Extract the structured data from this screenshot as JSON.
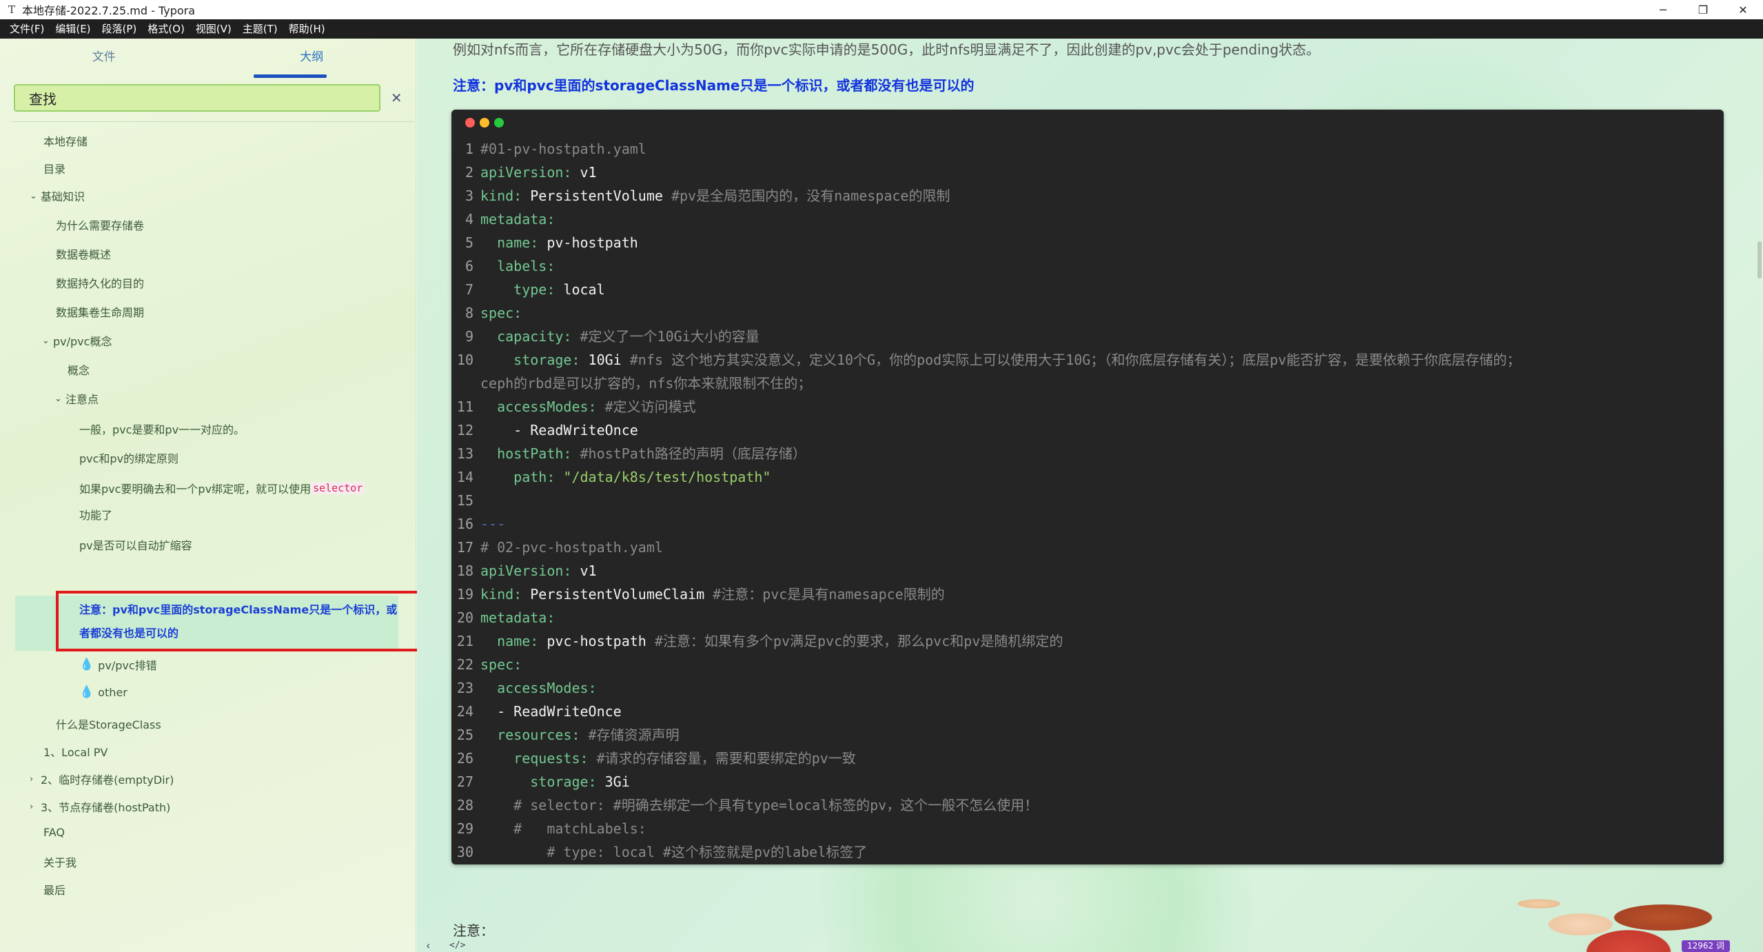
{
  "window": {
    "app_icon": "T",
    "title": "本地存储-2022.7.25.md - Typora",
    "minimize": "─",
    "maximize": "❐",
    "close": "✕"
  },
  "menu": [
    "文件(F)",
    "编辑(E)",
    "段落(P)",
    "格式(O)",
    "视图(V)",
    "主题(T)",
    "帮助(H)"
  ],
  "sidebar": {
    "tabs": {
      "files": "文件",
      "outline": "大纲"
    },
    "search": {
      "value": "查找",
      "close": "✕"
    },
    "outline": {
      "i1": "本地存储",
      "i2": "目录",
      "i3": "基础知识",
      "i4": "为什么需要存储卷",
      "i5": "数据卷概述",
      "i6": "数据持久化的目的",
      "i7": "数据集卷生命周期",
      "i8": "pv/pvc概念",
      "i9": "概念",
      "i10": "注意点",
      "i11": "一般，pvc是要和pv一一对应的。",
      "i12": "pvc和pv的绑定原则",
      "i13a": "如果pvc要明确去和一个pv绑定呢，就可以使用",
      "i13code": "selector",
      "i13b": "功能了",
      "i14": "pv是否可以自动扩缩容",
      "active": "注意：pv和pvc里面的storageClassName只是一个标识，或者都没有也是可以的",
      "i16": "pv/pvc排错",
      "i17": "other",
      "i18": "什么是StorageClass",
      "i19": "1、Local PV",
      "i20": "2、临时存储卷(emptyDir)",
      "i21": "3、节点存储卷(hostPath)",
      "i22": "FAQ",
      "i23": "关于我",
      "i24": "最后"
    }
  },
  "content": {
    "para1": "例如对nfs而言，它所在存储硬盘大小为50G，而你pvc实际申请的是500G，此时nfs明显满足不了，因此创建的pv,pvc会处于pending状态。",
    "note": "注意：pv和pvc里面的storageClassName只是一个标识，或者都没有也是可以的",
    "bottom_note": "注意：",
    "code": {
      "l1": "#01-pv-hostpath.yaml",
      "l2k": "apiVersion:",
      "l2v": " v1",
      "l3k": "kind:",
      "l3v": " PersistentVolume ",
      "l3c": "#pv是全局范围内的，没有namespace的限制",
      "l4k": "metadata:",
      "l5k": "  name:",
      "l5v": " pv-hostpath",
      "l6k": "  labels:",
      "l7k": "    type:",
      "l7v": " local",
      "l8k": "spec:",
      "l9k": "  capacity:",
      "l9c": " #定义了一个10Gi大小的容量",
      "l10k": "    storage:",
      "l10v": " 10Gi ",
      "l10c": "#nfs 这个地方其实没意义，定义10个G，你的pod实际上可以使用大于10G；（和你底层存储有关）；底层pv能否扩容，是要依赖于你底层存储的；",
      "l10w": "ceph的rbd是可以扩容的，nfs你本来就限制不住的；",
      "l11k": "  accessModes:",
      "l11c": " #定义访问模式",
      "l12v": "    - ReadWriteOnce",
      "l13k": "  hostPath:",
      "l13c": " #hostPath路径的声明（底层存储）",
      "l14k": "    path:",
      "l14s": " \"/data/k8s/test/hostpath\"",
      "l15": "",
      "l16": "---",
      "l17": "# 02-pvc-hostpath.yaml",
      "l18k": "apiVersion:",
      "l18v": " v1",
      "l19k": "kind:",
      "l19v": " PersistentVolumeClaim ",
      "l19c": "#注意：pvc是具有namesapce限制的",
      "l20k": "metadata:",
      "l21k": "  name:",
      "l21v": " pvc-hostpath ",
      "l21c": "#注意：如果有多个pv满足pvc的要求，那么pvc和pv是随机绑定的",
      "l22k": "spec:",
      "l23k": "  accessModes:",
      "l24v": "  - ReadWriteOnce",
      "l25k": "  resources:",
      "l25c": " #存储资源声明",
      "l26k": "    requests:",
      "l26c": " #请求的存储容量，需要和要绑定的pv一致",
      "l27k": "      storage:",
      "l27v": " 3Gi",
      "l28c": "    # selector: #明确去绑定一个具有type=local标签的pv，这个一般不怎么使用！",
      "l29c": "    #   matchLabels:",
      "l30c": "        # type: local #这个标签就是pv的label标签了"
    }
  },
  "status": {
    "word_count": "12962 词",
    "outline_toggle": "‹",
    "source_toggle": "</>"
  },
  "colors": {
    "keyword": "#73c991",
    "comment": "#8a8a8a",
    "string": "#9ad06a",
    "note": "#1133dd",
    "highlight_border": "#e01a1a"
  }
}
